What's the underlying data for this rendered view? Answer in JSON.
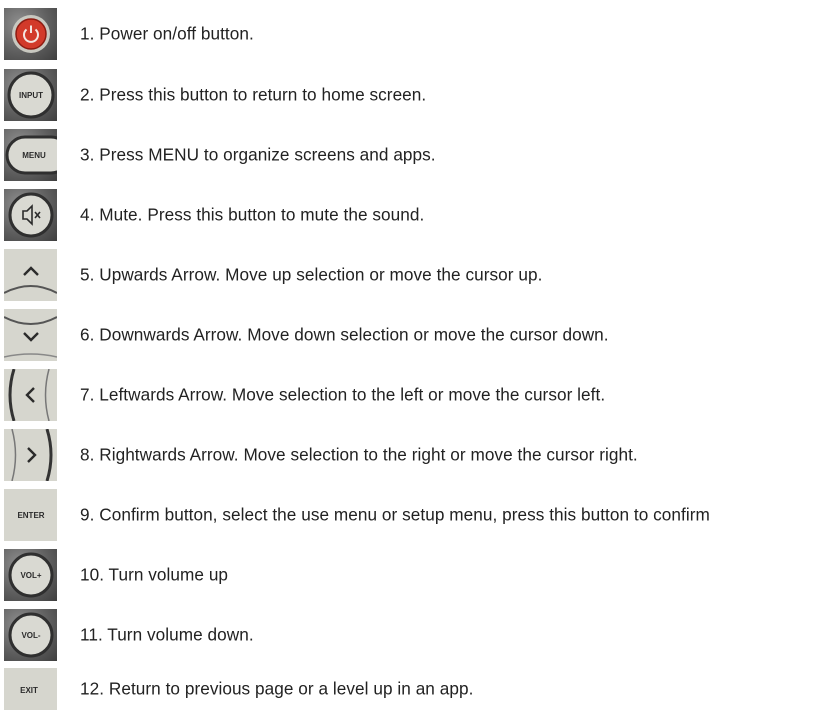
{
  "buttons": [
    {
      "icon": "power-icon",
      "text": "1.  Power on/off button."
    },
    {
      "icon": "input-button-icon",
      "icon_text": "INPUT",
      "text": "2.  Press this button to return to home screen."
    },
    {
      "icon": "menu-button-icon",
      "icon_text": "MENU",
      "text": "3.  Press MENU to organize screens and apps."
    },
    {
      "icon": "mute-icon",
      "text": "4.  Mute. Press this button to mute the sound."
    },
    {
      "icon": "up-arrow-icon",
      "text": "5.   Upwards Arrow. Move up selection or move the cursor up."
    },
    {
      "icon": "down-arrow-icon",
      "text": "6.  Downwards Arrow. Move down selection or move the cursor down."
    },
    {
      "icon": "left-arrow-icon",
      "text": "7.  Leftwards Arrow. Move selection to the left or move the cursor left."
    },
    {
      "icon": "right-arrow-icon",
      "text": "8.  Rightwards Arrow. Move selection to the right or move the cursor right."
    },
    {
      "icon": "enter-button-icon",
      "icon_text": "ENTER",
      "text": "9.  Confirm button, select the use menu or setup menu, press this button to confirm"
    },
    {
      "icon": "volume-up-icon",
      "icon_text": "VOL+",
      "text": "10.  Turn volume up"
    },
    {
      "icon": "volume-down-icon",
      "icon_text": "VOL-",
      "text": "11.  Turn volume down."
    },
    {
      "icon": "exit-button-icon",
      "icon_text": "EXIT",
      "text": "12.  Return to previous page or a level up in an app."
    }
  ]
}
